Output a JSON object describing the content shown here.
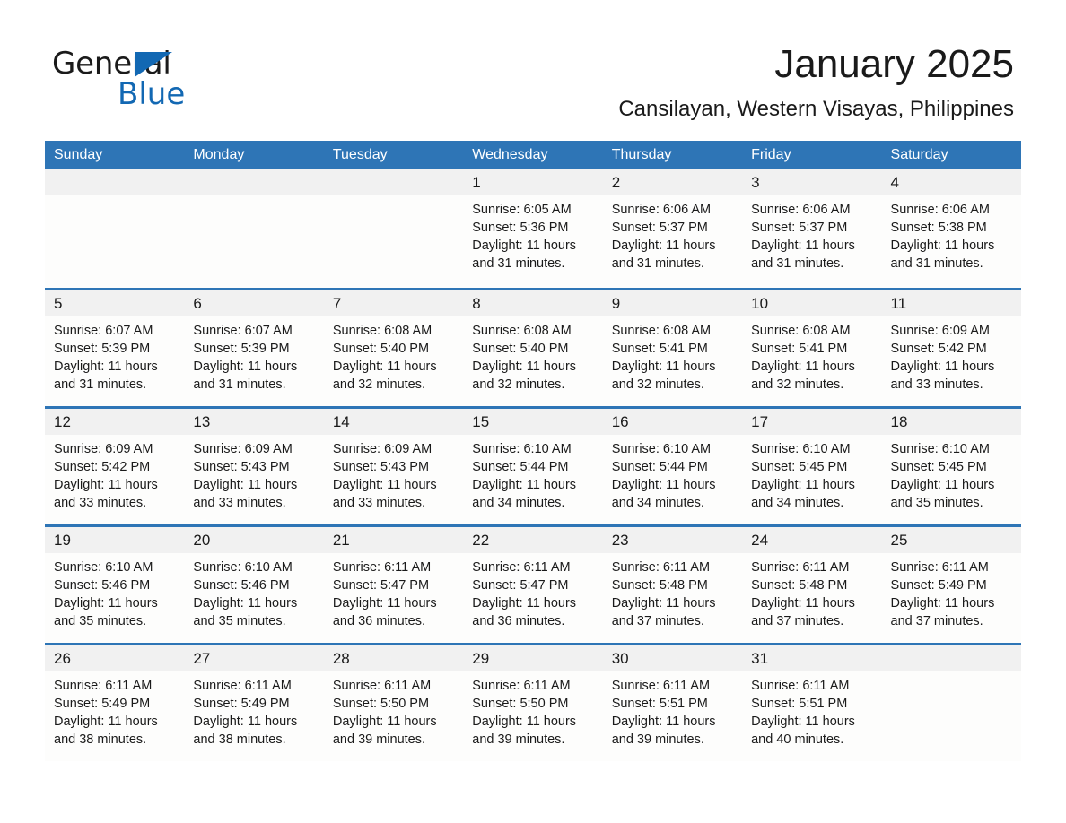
{
  "brand": {
    "name_part1": "General",
    "name_part2": "Blue",
    "triangle_color": "#1268b3"
  },
  "header": {
    "title": "January 2025",
    "subtitle": "Cansilayan, Western Visayas, Philippines"
  },
  "theme": {
    "header_blue": "#2e75b6",
    "day_band_gray": "#f1f1f1",
    "cell_bg": "#fdfdfc",
    "text": "#1a1a1a"
  },
  "weekdays": [
    "Sunday",
    "Monday",
    "Tuesday",
    "Wednesday",
    "Thursday",
    "Friday",
    "Saturday"
  ],
  "weeks": [
    [
      {
        "day": "",
        "sunrise": "",
        "sunset": "",
        "daylight1": "",
        "daylight2": ""
      },
      {
        "day": "",
        "sunrise": "",
        "sunset": "",
        "daylight1": "",
        "daylight2": ""
      },
      {
        "day": "",
        "sunrise": "",
        "sunset": "",
        "daylight1": "",
        "daylight2": ""
      },
      {
        "day": "1",
        "sunrise": "Sunrise: 6:05 AM",
        "sunset": "Sunset: 5:36 PM",
        "daylight1": "Daylight: 11 hours",
        "daylight2": "and 31 minutes."
      },
      {
        "day": "2",
        "sunrise": "Sunrise: 6:06 AM",
        "sunset": "Sunset: 5:37 PM",
        "daylight1": "Daylight: 11 hours",
        "daylight2": "and 31 minutes."
      },
      {
        "day": "3",
        "sunrise": "Sunrise: 6:06 AM",
        "sunset": "Sunset: 5:37 PM",
        "daylight1": "Daylight: 11 hours",
        "daylight2": "and 31 minutes."
      },
      {
        "day": "4",
        "sunrise": "Sunrise: 6:06 AM",
        "sunset": "Sunset: 5:38 PM",
        "daylight1": "Daylight: 11 hours",
        "daylight2": "and 31 minutes."
      }
    ],
    [
      {
        "day": "5",
        "sunrise": "Sunrise: 6:07 AM",
        "sunset": "Sunset: 5:39 PM",
        "daylight1": "Daylight: 11 hours",
        "daylight2": "and 31 minutes."
      },
      {
        "day": "6",
        "sunrise": "Sunrise: 6:07 AM",
        "sunset": "Sunset: 5:39 PM",
        "daylight1": "Daylight: 11 hours",
        "daylight2": "and 31 minutes."
      },
      {
        "day": "7",
        "sunrise": "Sunrise: 6:08 AM",
        "sunset": "Sunset: 5:40 PM",
        "daylight1": "Daylight: 11 hours",
        "daylight2": "and 32 minutes."
      },
      {
        "day": "8",
        "sunrise": "Sunrise: 6:08 AM",
        "sunset": "Sunset: 5:40 PM",
        "daylight1": "Daylight: 11 hours",
        "daylight2": "and 32 minutes."
      },
      {
        "day": "9",
        "sunrise": "Sunrise: 6:08 AM",
        "sunset": "Sunset: 5:41 PM",
        "daylight1": "Daylight: 11 hours",
        "daylight2": "and 32 minutes."
      },
      {
        "day": "10",
        "sunrise": "Sunrise: 6:08 AM",
        "sunset": "Sunset: 5:41 PM",
        "daylight1": "Daylight: 11 hours",
        "daylight2": "and 32 minutes."
      },
      {
        "day": "11",
        "sunrise": "Sunrise: 6:09 AM",
        "sunset": "Sunset: 5:42 PM",
        "daylight1": "Daylight: 11 hours",
        "daylight2": "and 33 minutes."
      }
    ],
    [
      {
        "day": "12",
        "sunrise": "Sunrise: 6:09 AM",
        "sunset": "Sunset: 5:42 PM",
        "daylight1": "Daylight: 11 hours",
        "daylight2": "and 33 minutes."
      },
      {
        "day": "13",
        "sunrise": "Sunrise: 6:09 AM",
        "sunset": "Sunset: 5:43 PM",
        "daylight1": "Daylight: 11 hours",
        "daylight2": "and 33 minutes."
      },
      {
        "day": "14",
        "sunrise": "Sunrise: 6:09 AM",
        "sunset": "Sunset: 5:43 PM",
        "daylight1": "Daylight: 11 hours",
        "daylight2": "and 33 minutes."
      },
      {
        "day": "15",
        "sunrise": "Sunrise: 6:10 AM",
        "sunset": "Sunset: 5:44 PM",
        "daylight1": "Daylight: 11 hours",
        "daylight2": "and 34 minutes."
      },
      {
        "day": "16",
        "sunrise": "Sunrise: 6:10 AM",
        "sunset": "Sunset: 5:44 PM",
        "daylight1": "Daylight: 11 hours",
        "daylight2": "and 34 minutes."
      },
      {
        "day": "17",
        "sunrise": "Sunrise: 6:10 AM",
        "sunset": "Sunset: 5:45 PM",
        "daylight1": "Daylight: 11 hours",
        "daylight2": "and 34 minutes."
      },
      {
        "day": "18",
        "sunrise": "Sunrise: 6:10 AM",
        "sunset": "Sunset: 5:45 PM",
        "daylight1": "Daylight: 11 hours",
        "daylight2": "and 35 minutes."
      }
    ],
    [
      {
        "day": "19",
        "sunrise": "Sunrise: 6:10 AM",
        "sunset": "Sunset: 5:46 PM",
        "daylight1": "Daylight: 11 hours",
        "daylight2": "and 35 minutes."
      },
      {
        "day": "20",
        "sunrise": "Sunrise: 6:10 AM",
        "sunset": "Sunset: 5:46 PM",
        "daylight1": "Daylight: 11 hours",
        "daylight2": "and 35 minutes."
      },
      {
        "day": "21",
        "sunrise": "Sunrise: 6:11 AM",
        "sunset": "Sunset: 5:47 PM",
        "daylight1": "Daylight: 11 hours",
        "daylight2": "and 36 minutes."
      },
      {
        "day": "22",
        "sunrise": "Sunrise: 6:11 AM",
        "sunset": "Sunset: 5:47 PM",
        "daylight1": "Daylight: 11 hours",
        "daylight2": "and 36 minutes."
      },
      {
        "day": "23",
        "sunrise": "Sunrise: 6:11 AM",
        "sunset": "Sunset: 5:48 PM",
        "daylight1": "Daylight: 11 hours",
        "daylight2": "and 37 minutes."
      },
      {
        "day": "24",
        "sunrise": "Sunrise: 6:11 AM",
        "sunset": "Sunset: 5:48 PM",
        "daylight1": "Daylight: 11 hours",
        "daylight2": "and 37 minutes."
      },
      {
        "day": "25",
        "sunrise": "Sunrise: 6:11 AM",
        "sunset": "Sunset: 5:49 PM",
        "daylight1": "Daylight: 11 hours",
        "daylight2": "and 37 minutes."
      }
    ],
    [
      {
        "day": "26",
        "sunrise": "Sunrise: 6:11 AM",
        "sunset": "Sunset: 5:49 PM",
        "daylight1": "Daylight: 11 hours",
        "daylight2": "and 38 minutes."
      },
      {
        "day": "27",
        "sunrise": "Sunrise: 6:11 AM",
        "sunset": "Sunset: 5:49 PM",
        "daylight1": "Daylight: 11 hours",
        "daylight2": "and 38 minutes."
      },
      {
        "day": "28",
        "sunrise": "Sunrise: 6:11 AM",
        "sunset": "Sunset: 5:50 PM",
        "daylight1": "Daylight: 11 hours",
        "daylight2": "and 39 minutes."
      },
      {
        "day": "29",
        "sunrise": "Sunrise: 6:11 AM",
        "sunset": "Sunset: 5:50 PM",
        "daylight1": "Daylight: 11 hours",
        "daylight2": "and 39 minutes."
      },
      {
        "day": "30",
        "sunrise": "Sunrise: 6:11 AM",
        "sunset": "Sunset: 5:51 PM",
        "daylight1": "Daylight: 11 hours",
        "daylight2": "and 39 minutes."
      },
      {
        "day": "31",
        "sunrise": "Sunrise: 6:11 AM",
        "sunset": "Sunset: 5:51 PM",
        "daylight1": "Daylight: 11 hours",
        "daylight2": "and 40 minutes."
      },
      {
        "day": "",
        "sunrise": "",
        "sunset": "",
        "daylight1": "",
        "daylight2": ""
      }
    ]
  ]
}
